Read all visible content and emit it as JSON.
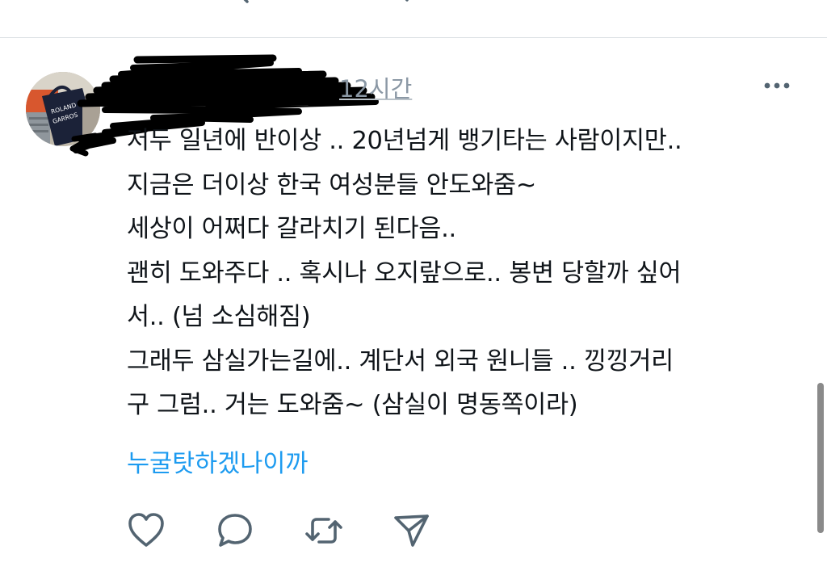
{
  "tweet": {
    "time": "12시간",
    "lines": [
      "저두 일년에 반이상 .. 20년넘게 뱅기타는 사람이지만..",
      "지금은 더이상 한국 여성분들 안도와줌~",
      "세상이 어쩌다 갈라치기 된다음..",
      "괜히 도와주다 .. 혹시나 오지랖으로.. 봉변 당할까 싶어",
      "서.. (넘 소심해짐)",
      "그래두 삼실가는길에.. 계단서 외국 원니들 .. 낑낑거리",
      "구 그럼.. 거는 도와줌~ (삼실이 명동쪽이라)"
    ],
    "link_text": "누굴탓하겠나이까"
  },
  "avatar": {
    "bag_text_1": "ROLAND",
    "bag_text_2": "GARROS"
  },
  "icons": {
    "more": "more-horizontal-icon",
    "like": "heart-icon",
    "reply": "reply-bubble-icon",
    "retweet": "retweet-icon",
    "share": "share-arrow-icon"
  },
  "colors": {
    "text": "#0f1419",
    "secondary": "#8b98a5",
    "link": "#1d9bf0",
    "icon": "#536471",
    "divider": "#dfe3e6"
  }
}
